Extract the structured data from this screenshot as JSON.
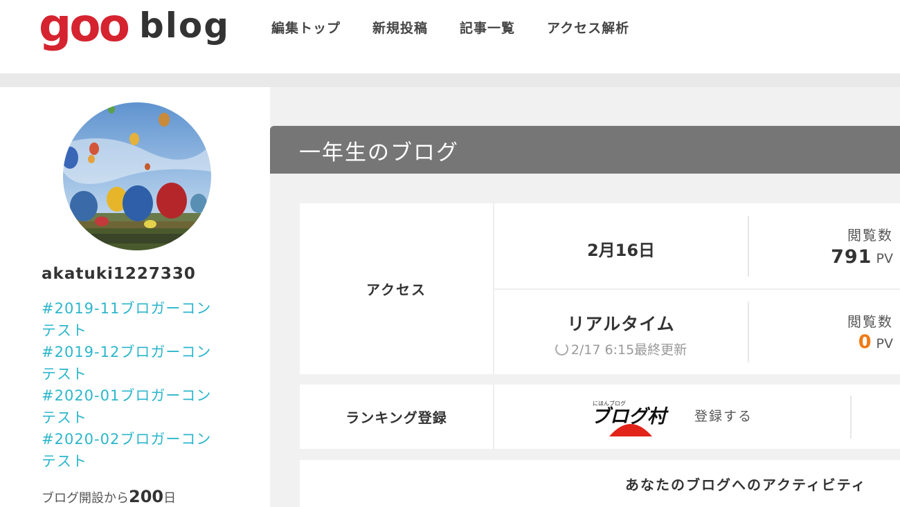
{
  "header": {
    "logo_goo": "goo",
    "logo_blog": "blog",
    "nav": [
      "編集トップ",
      "新規投稿",
      "記事一覧",
      "アクセス解析"
    ]
  },
  "sidebar": {
    "username": "akatuki1227330",
    "tags": [
      "#2019-11ブロガーコンテスト",
      "#2019-12ブロガーコンテスト",
      "#2020-01ブロガーコンテスト",
      "#2020-02ブロガーコンテスト"
    ],
    "days_prefix": "ブログ開設から",
    "days_count": "200",
    "days_suffix": "日"
  },
  "main": {
    "blog_title": "一年生のブログ",
    "access": {
      "label": "アクセス",
      "date": "2月16日",
      "date_caption": "閲覧数",
      "date_pv": "791",
      "pv_unit": "PV",
      "realtime_label": "リアルタイム",
      "updated": "2/17 6:15最終更新",
      "realtime_caption": "閲覧数",
      "realtime_pv": "0"
    },
    "ranking": {
      "label": "ランキング登録",
      "logo_small": "にほんブログ",
      "logo_text": "ブログ村",
      "register_label": "登録する"
    },
    "activity": {
      "title": "あなたのブログへのアクティビティ"
    }
  },
  "colors": {
    "brand_red": "#d5232f",
    "tag_link": "#2cb6cc",
    "title_bar": "#767676",
    "zero_pv": "#f07a16"
  }
}
